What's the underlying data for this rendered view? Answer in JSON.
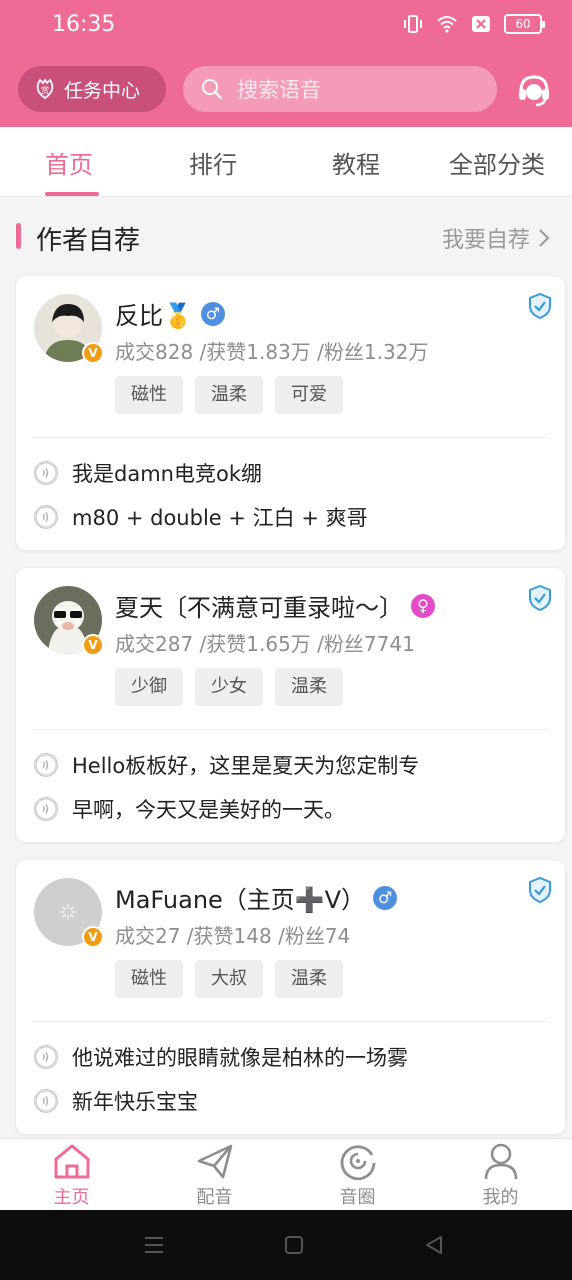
{
  "status_bar": {
    "time": "16:35",
    "battery": "60"
  },
  "header": {
    "task_center_label": "任务中心",
    "search_placeholder": "搜索语音"
  },
  "tabs": [
    {
      "label": "首页",
      "active": true
    },
    {
      "label": "排行",
      "active": false
    },
    {
      "label": "教程",
      "active": false
    },
    {
      "label": "全部分类",
      "active": false
    }
  ],
  "section": {
    "title": "作者自荐",
    "action_label": "我要自荐"
  },
  "authors": [
    {
      "name": "反比🥇",
      "gender": "♂",
      "stats": "成交828 /获赞1.83万 /粉丝1.32万",
      "tags": [
        "磁性",
        "温柔",
        "可爱"
      ],
      "voices": [
        "我是damn电竞ok绷",
        "m80 + double + 江白 + 爽哥"
      ]
    },
    {
      "name": "夏天〔不满意可重录啦～〕",
      "gender": "♀",
      "stats": "成交287 /获赞1.65万 /粉丝7741",
      "tags": [
        "少御",
        "少女",
        "温柔"
      ],
      "voices": [
        " Hello板板好，这里是夏天为您定制专",
        "早啊，今天又是美好的一天。"
      ]
    },
    {
      "name": "MaFuane（主页➕V）",
      "gender": "♂",
      "stats": "成交27 /获赞148 /粉丝74",
      "tags": [
        "磁性",
        "大叔",
        "温柔"
      ],
      "voices": [
        "他说难过的眼睛就像是柏林的一场雾",
        "新年快乐宝宝"
      ]
    }
  ],
  "bottom_nav": [
    {
      "label": "主页",
      "icon": "home-icon",
      "active": true
    },
    {
      "label": "配音",
      "icon": "paper-plane-icon",
      "active": false
    },
    {
      "label": "音圈",
      "icon": "circle-refresh-icon",
      "active": false
    },
    {
      "label": "我的",
      "icon": "person-icon",
      "active": false
    }
  ],
  "colors": {
    "brand": "#ee6b96",
    "male": "#4f8fe0",
    "female": "#e44bc8",
    "verified": "#f39c12"
  }
}
